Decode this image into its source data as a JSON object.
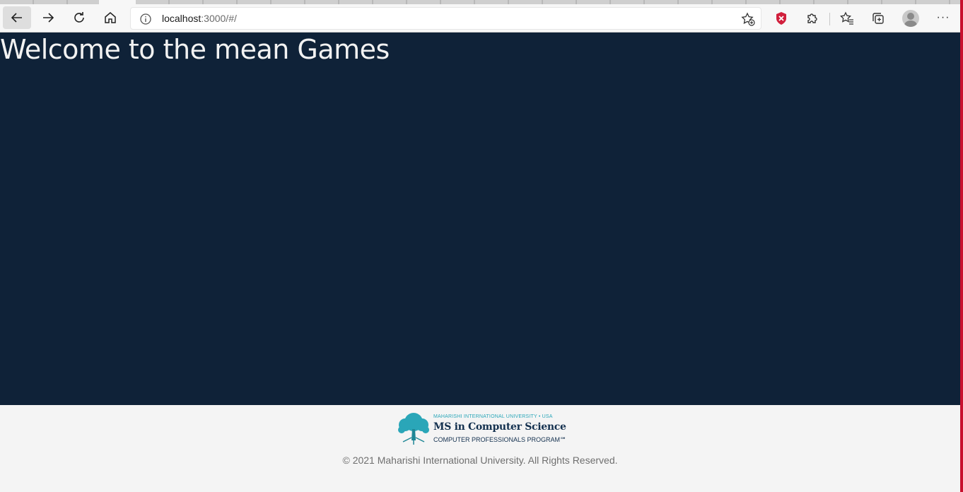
{
  "browser": {
    "address": {
      "host": "localhost",
      "path": ":3000/#/"
    },
    "icons": {
      "back": "back-arrow-icon",
      "forward": "forward-arrow-icon",
      "reload": "reload-icon",
      "home": "home-icon",
      "site_info": "info-icon",
      "add_favorite": "add-favorite-icon",
      "shield": "shield-extension-icon",
      "extensions": "puzzle-icon",
      "favorites": "favorites-icon",
      "collections": "collections-icon",
      "profile": "profile-avatar",
      "more": "more-icon"
    },
    "more_label": "···"
  },
  "page": {
    "heading": "Welcome to the mean Games",
    "hero_color": "#0f2238"
  },
  "footer": {
    "logo": {
      "line1": "MAHARISHI INTERNATIONAL UNIVERSITY • USA",
      "line2": "MS in Computer Science",
      "line3": "COMPUTER PROFESSIONALS PROGRAM℠"
    },
    "copyright": "© 2021 Maharishi International University. All Rights Reserved."
  }
}
